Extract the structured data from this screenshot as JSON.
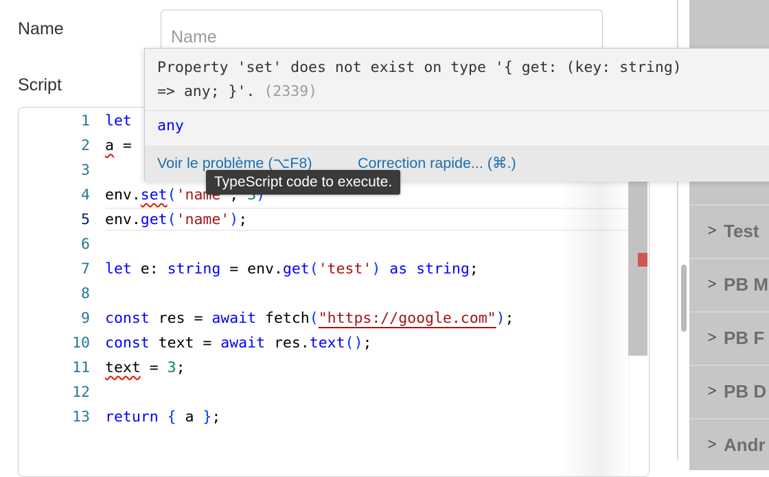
{
  "form": {
    "name_label": "Name",
    "name_value": "",
    "name_placeholder": "Name",
    "script_label": "Script"
  },
  "editor": {
    "active_line": 5,
    "line_numbers": [
      "1",
      "2",
      "3",
      "4",
      "5",
      "6",
      "7",
      "8",
      "9",
      "10",
      "11",
      "12",
      "13"
    ],
    "code_lines": [
      "let ",
      "a = ",
      "",
      "env.set('name', 3)",
      "env.get('name');",
      "",
      "let e: string = env.get('test') as string;",
      "",
      "const res = await fetch(\"https://google.com\");",
      "const text = await res.text();",
      "text = 3;",
      "",
      "return { a };"
    ]
  },
  "hover": {
    "message_line1": "Property 'set' does not exist on type '{ get: (key: string)",
    "message_line2": "=> any; }'.",
    "error_code": "(2339)",
    "type_info": "any",
    "view_problem": "Voir le problème (⌥F8)",
    "quick_fix": "Correction rapide... (⌘.)"
  },
  "tooltip": {
    "text": "TypeScript code to execute."
  },
  "sidebar": {
    "items": [
      {
        "label": "Test"
      },
      {
        "label": "PB M"
      },
      {
        "label": "PB F"
      },
      {
        "label": "PB D"
      },
      {
        "label": "Andr"
      }
    ]
  },
  "colors": {
    "keyword": "#0000ff",
    "string": "#a31515",
    "number": "#098658",
    "line_number": "#237893",
    "error_squiggle": "#e51400",
    "hover_link": "#1a6fb0",
    "tooltip_bg": "#3a3a3a",
    "sidebar_bg": "#c6c6c6"
  },
  "icons": {
    "sidebar_expand": "chevron-right-icon"
  }
}
